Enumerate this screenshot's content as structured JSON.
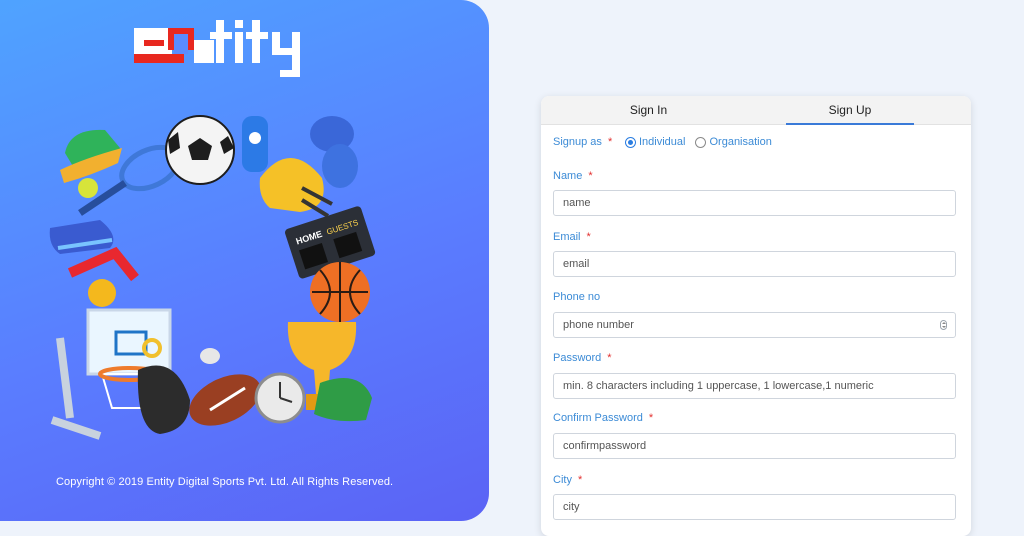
{
  "brand": {
    "logo_text": "entity"
  },
  "footer": {
    "copyright": "Copyright © 2019 Entity Digital Sports Pvt. Ltd. All Rights Reserved."
  },
  "illustration": {
    "scoreboard": {
      "home": "HOME",
      "guests": "GUESTS"
    }
  },
  "auth": {
    "tabs": [
      {
        "label": "Sign In"
      },
      {
        "label": "Sign Up",
        "active": true
      }
    ],
    "signup_as": {
      "label": "Signup as",
      "options": [
        {
          "label": "Individual",
          "selected": true
        },
        {
          "label": "Organisation",
          "selected": false
        }
      ]
    },
    "fields": {
      "name": {
        "label": "Name",
        "placeholder": "name",
        "required": true
      },
      "email": {
        "label": "Email",
        "placeholder": "email",
        "required": true
      },
      "phone": {
        "label": "Phone no",
        "placeholder": "phone number",
        "required": false
      },
      "password": {
        "label": "Password",
        "placeholder": "min. 8 characters including 1 uppercase, 1 lowercase,1 numeric",
        "required": true
      },
      "confirm_password": {
        "label": "Confirm Password",
        "placeholder": "confirmpassword",
        "required": true
      },
      "city": {
        "label": "City",
        "placeholder": "city",
        "required": true
      }
    },
    "required_marker": "*"
  },
  "colors": {
    "accent": "#3c8bd6",
    "required": "#e3302f",
    "hero_start": "#4fa3ff",
    "hero_end": "#5b63f5"
  }
}
